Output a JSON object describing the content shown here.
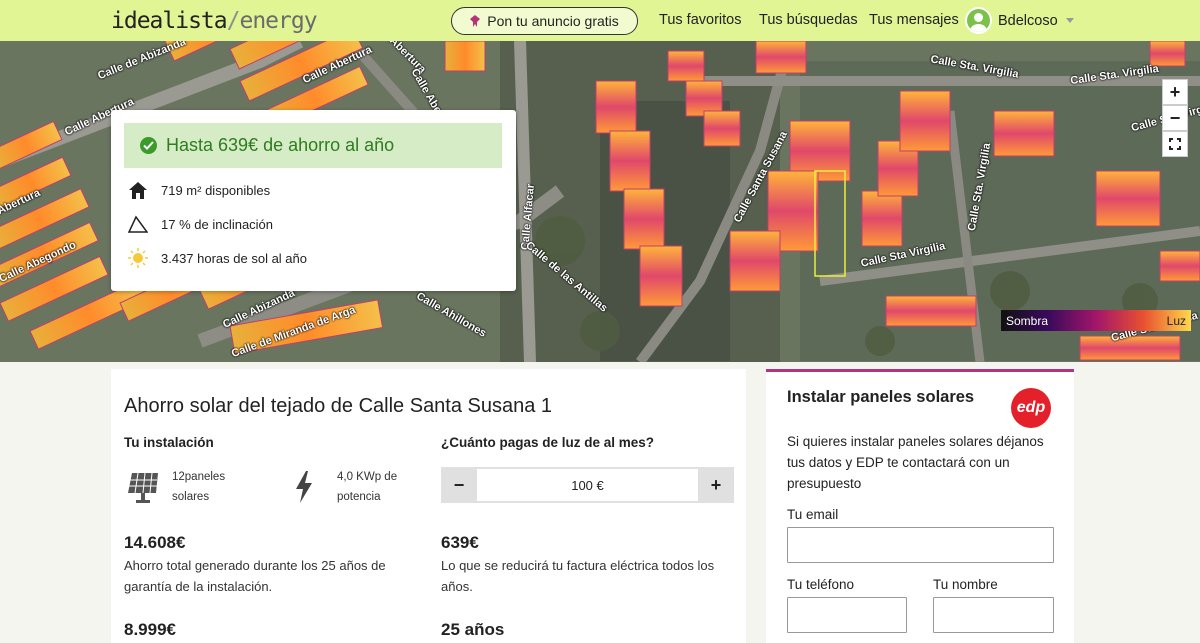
{
  "header": {
    "logo_main": "idealista",
    "logo_slash": "/",
    "logo_sub": "energy",
    "cta_label": "Pon tu anuncio gratis",
    "nav": [
      "Tus favoritos",
      "Tus búsquedas",
      "Tus mensajes"
    ],
    "username": "Bdelcoso"
  },
  "map": {
    "streets": [
      "Calle de Abizanda",
      "Calle Abertura",
      "Calle Abertura",
      "Abertura",
      "Calle Abegondo",
      "Calle Abertura",
      "Calle Abertura",
      "Calle Abizanda",
      "Calle de Miranda de Arga",
      "Calle Ahillones",
      "Calle Alfacar",
      "Calle de las Antillas",
      "Calle Santa Susana",
      "Calle Sta. Virgilia",
      "Calle Sta. Virgilia",
      "Calle Sta. Virgilia",
      "Calle Sta. Virgilia",
      "Calle Sta Virgilia",
      "Calle Sta. Virgilia"
    ],
    "legend_low": "Sombra",
    "legend_high": "Luz",
    "zoom_in": "+",
    "zoom_out": "−"
  },
  "info": {
    "saving": "Hasta 639€ de ahorro al año",
    "area": "719 m² disponibles",
    "inclination": "17 % de inclinación",
    "sun_hours": "3.437 horas de sol al año"
  },
  "main": {
    "title": "Ahorro solar del tejado de Calle Santa Susana 1",
    "installation_heading": "Tu instalación",
    "panels_text_1": "12paneles",
    "panels_text_2": "solares",
    "power_text_1": "4,0 KWp de",
    "power_text_2": "potencia",
    "bill_heading": "¿Cuánto pagas de luz de al mes?",
    "stepper_minus": "−",
    "stepper_value": "100 €",
    "stepper_plus": "+",
    "total_value": "14.608€",
    "total_desc": "Ahorro total generado durante los 25 años de garantía de la instalación.",
    "reduction_value": "639€",
    "reduction_desc": "Lo que se reducirá tu factura eléctrica todos los años.",
    "cost_value": "8.999€",
    "years_value": "25 años"
  },
  "form": {
    "title": "Instalar paneles solares",
    "brand": "edp",
    "text": "Si quieres instalar paneles solares déjanos tus datos y EDP te contactará con un presupuesto",
    "email_label": "Tu email",
    "phone_label": "Tu teléfono",
    "name_label": "Tu nombre"
  },
  "colors": {
    "header_bg": "#e1f595",
    "saving_bg": "#d6ecc7",
    "saving_text": "#2e7d1e",
    "form_accent": "#b5337b",
    "edp_red": "#e4202a"
  }
}
